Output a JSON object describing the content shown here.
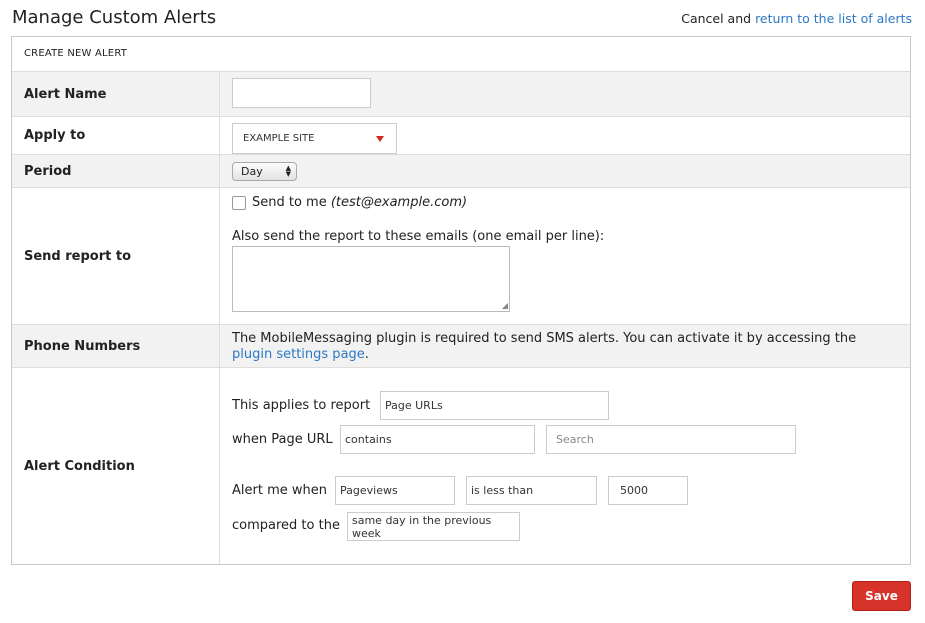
{
  "page": {
    "title": "Manage Custom Alerts",
    "cancel_prefix": "Cancel and",
    "return_link": "return to the list of alerts"
  },
  "form": {
    "header": "CREATE NEW ALERT",
    "alert_name": {
      "label": "Alert Name",
      "value": ""
    },
    "apply_to": {
      "label": "Apply to",
      "selected": "EXAMPLE SITE"
    },
    "period": {
      "label": "Period",
      "selected": "Day"
    },
    "send_report": {
      "label": "Send report to",
      "send_to_me": "Send to me",
      "email": "(test@example.com)",
      "also_send": "Also send the report to these emails (one email per line):",
      "emails_value": ""
    },
    "phone": {
      "label": "Phone Numbers",
      "text": "The MobileMessaging plugin is required to send SMS alerts. You can activate it by accessing the",
      "link": "plugin settings page",
      "suffix": "."
    },
    "condition": {
      "label": "Alert Condition",
      "applies_to_label": "This applies to report",
      "report_value": "Page URLs",
      "when_label": "when Page URL",
      "match_value": "contains",
      "search_placeholder": "Search",
      "alert_me_label": "Alert me when",
      "metric_value": "Pageviews",
      "comparison_value": "is less than",
      "threshold_value": "5000",
      "compared_label": "compared to the",
      "compared_value": "same day in the previous week"
    }
  },
  "actions": {
    "save_label": "Save"
  },
  "colors": {
    "link": "#2b78c5",
    "save_button": "#d7332a",
    "dropdown_arrow": "#d4291f"
  }
}
